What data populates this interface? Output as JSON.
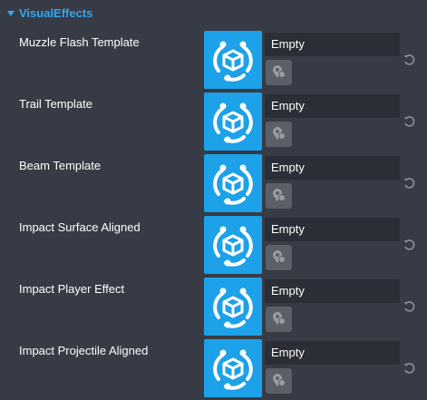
{
  "section": {
    "title": "VisualEffects"
  },
  "properties": [
    {
      "label": "Muzzle Flash Template",
      "value": "Empty",
      "thumbnail_icon": "smart-object-icon",
      "picker_icon": "asset-picker-icon",
      "reset_icon": "reset-icon"
    },
    {
      "label": "Trail Template",
      "value": "Empty",
      "thumbnail_icon": "smart-object-icon",
      "picker_icon": "asset-picker-icon",
      "reset_icon": "reset-icon"
    },
    {
      "label": "Beam Template",
      "value": "Empty",
      "thumbnail_icon": "smart-object-icon",
      "picker_icon": "asset-picker-icon",
      "reset_icon": "reset-icon"
    },
    {
      "label": "Impact Surface Aligned",
      "value": "Empty",
      "thumbnail_icon": "smart-object-icon",
      "picker_icon": "asset-picker-icon",
      "reset_icon": "reset-icon"
    },
    {
      "label": "Impact Player Effect",
      "value": "Empty",
      "thumbnail_icon": "smart-object-icon",
      "picker_icon": "asset-picker-icon",
      "reset_icon": "reset-icon"
    },
    {
      "label": "Impact Projectile Aligned",
      "value": "Empty",
      "thumbnail_icon": "smart-object-icon",
      "picker_icon": "asset-picker-icon",
      "reset_icon": "reset-icon"
    }
  ],
  "colors": {
    "background": "#373b45",
    "accent": "#32a6ee",
    "thumbnail": "#1da1e8",
    "field": "#2b2e36",
    "picker": "#5b5f68"
  }
}
